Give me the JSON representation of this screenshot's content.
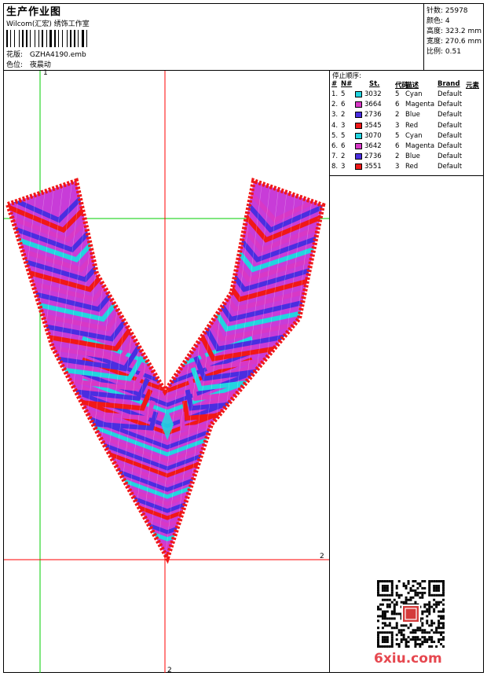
{
  "header": {
    "title": "生产作业图",
    "company": "Wilcom(汇宏) 绣饰工作室",
    "design_label": "花版:",
    "design_file": "GZHA4190.emb",
    "colorway_label": "色位:",
    "colorway": "夜晨动"
  },
  "stats": {
    "stitches": "针数: 25978",
    "colors": "颜色: 4",
    "height": "高度: 323.2 mm",
    "width": "宽度: 270.6 mm",
    "ratio": "比例: 0.51"
  },
  "stops": {
    "title": "停止顺序:",
    "headers": [
      "#",
      "N#",
      "St.",
      "代码",
      "描述",
      "Brand",
      "元素"
    ],
    "rows": [
      {
        "idx": "1.",
        "n": "5",
        "code": "3032",
        "num": "5",
        "desc": "Cyan",
        "brand": "Default",
        "color": "#22d4e0"
      },
      {
        "idx": "2.",
        "n": "6",
        "code": "3664",
        "num": "6",
        "desc": "Magenta",
        "brand": "Default",
        "color": "#d838c6"
      },
      {
        "idx": "3.",
        "n": "2",
        "code": "2736",
        "num": "2",
        "desc": "Blue",
        "brand": "Default",
        "color": "#4a2ee0"
      },
      {
        "idx": "4.",
        "n": "3",
        "code": "3545",
        "num": "3",
        "desc": "Red",
        "brand": "Default",
        "color": "#f01818"
      },
      {
        "idx": "5.",
        "n": "5",
        "code": "3070",
        "num": "5",
        "desc": "Cyan",
        "brand": "Default",
        "color": "#22d4e0"
      },
      {
        "idx": "6.",
        "n": "6",
        "code": "3642",
        "num": "6",
        "desc": "Magenta",
        "brand": "Default",
        "color": "#d838c6"
      },
      {
        "idx": "7.",
        "n": "2",
        "code": "2736",
        "num": "2",
        "desc": "Blue",
        "brand": "Default",
        "color": "#4a2ee0"
      },
      {
        "idx": "8.",
        "n": "3",
        "code": "3551",
        "num": "3",
        "desc": "Red",
        "brand": "Default",
        "color": "#f01818"
      }
    ]
  },
  "canvas": {
    "axis_top_label": "1",
    "axis_right_label": "2",
    "axis_bottom_label": "2",
    "guide_color": "#00cc00",
    "axis_color": "#ff0000"
  },
  "watermark": "6xiu.com",
  "colors": {
    "cyan": "#22d4e0",
    "magenta": "#d838c6",
    "blue": "#4a2ee0",
    "red": "#f01818"
  }
}
